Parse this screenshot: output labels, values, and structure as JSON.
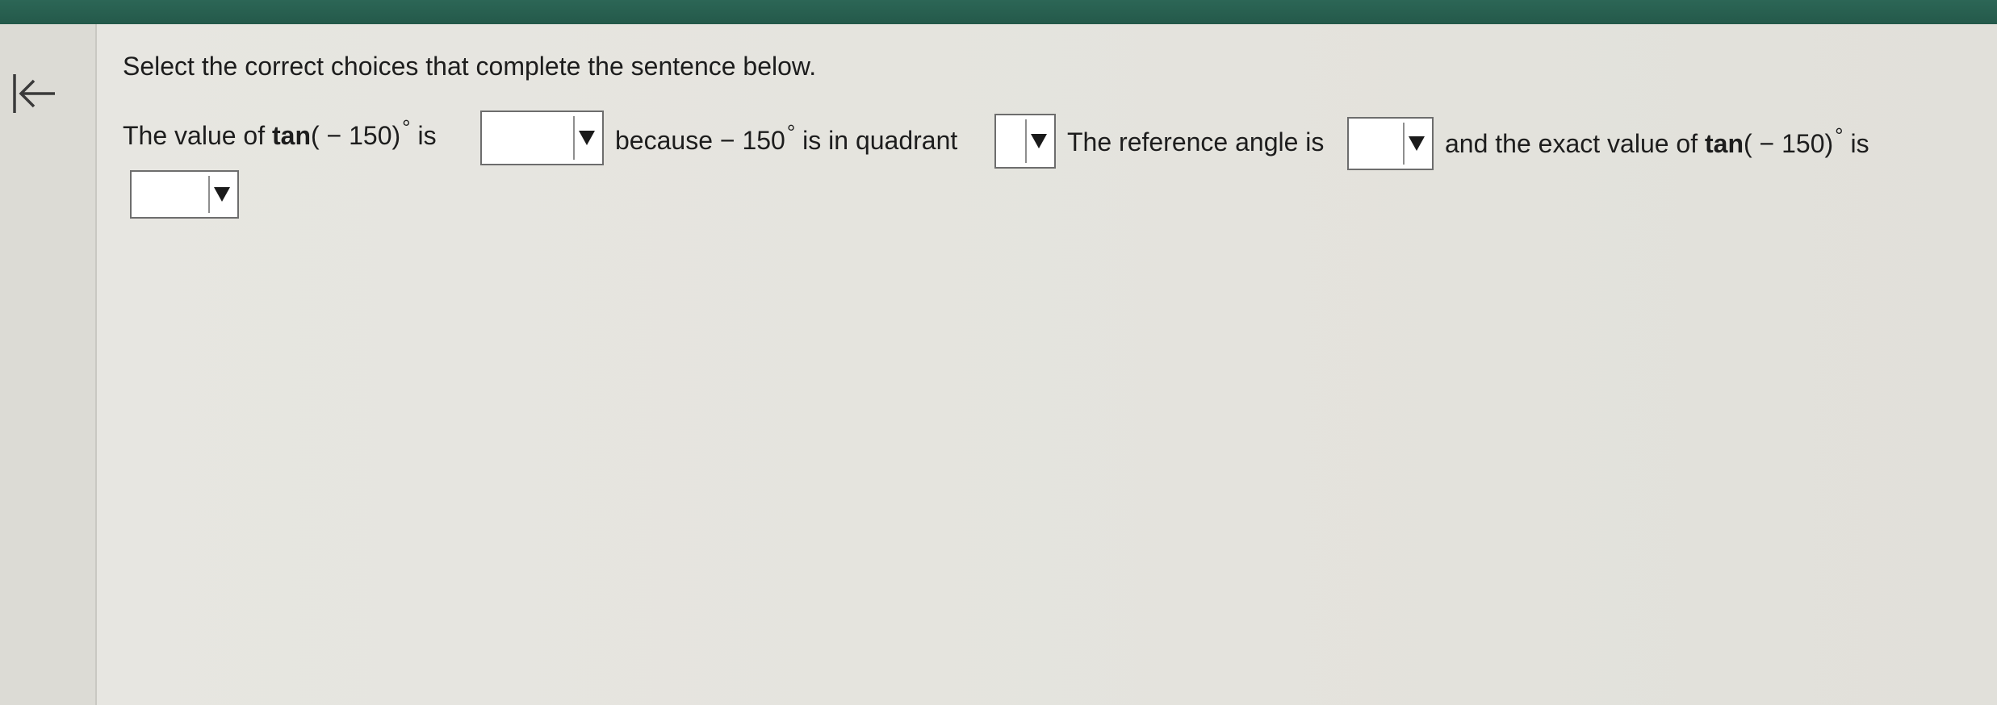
{
  "question": {
    "instruction": "Select the correct choices that complete the sentence below.",
    "seg1_text": "The value of ",
    "tan_label": "tan",
    "angle_expr": "( − 150)",
    "degree_symbol": "°",
    "seg2_text": " is",
    "seg3_text": "because  − 150",
    "seg4_text": " is in quadrant",
    "seg5_text": "The reference angle is",
    "seg6_text": "and the exact value of ",
    "seg7_text": " is"
  },
  "dropdowns": {
    "value_sign": {
      "selected": ""
    },
    "quadrant": {
      "selected": ""
    },
    "reference_angle": {
      "selected": ""
    },
    "exact_value": {
      "selected": ""
    }
  },
  "icons": {
    "collapse": "collapse-left-arrow-icon",
    "dropdown": "triangle-down-icon"
  },
  "colors": {
    "top_bar": "#24594a",
    "background": "#e4e3dd",
    "text": "#1d1d1d"
  }
}
